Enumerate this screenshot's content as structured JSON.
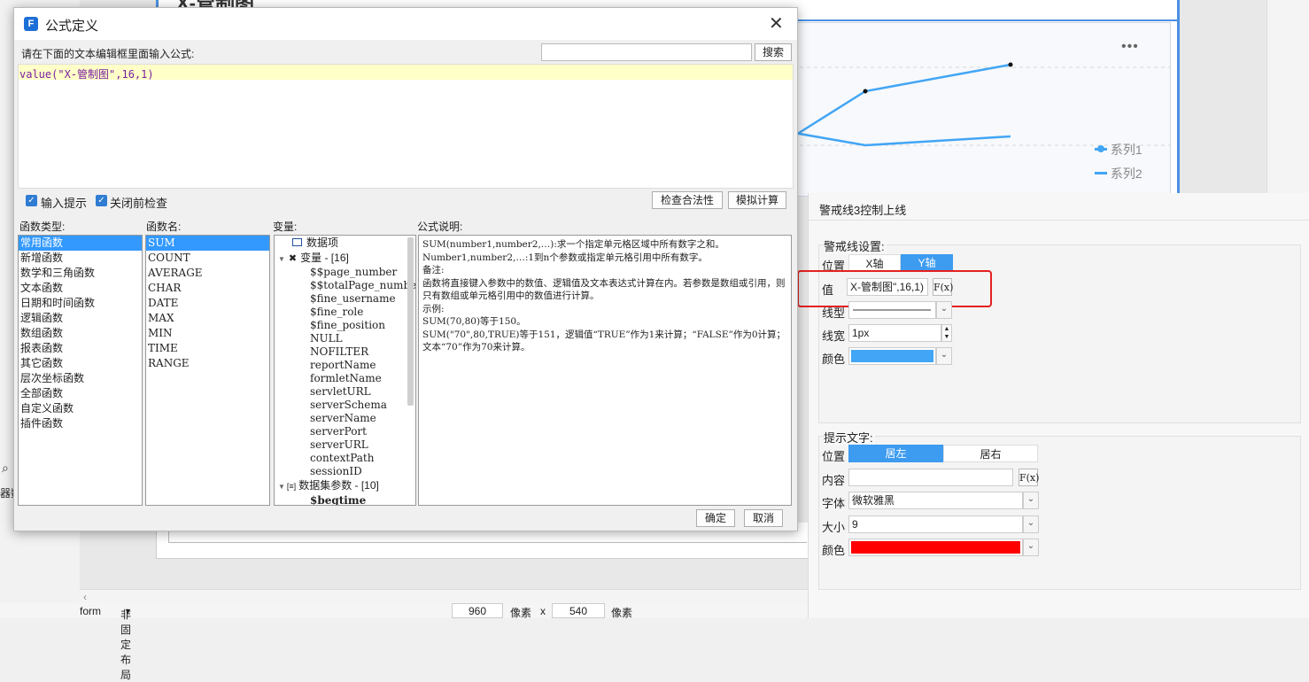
{
  "background": {
    "page_title_fragment": "X-管制图",
    "menu_dots": "•••",
    "legend": [
      {
        "name": "系列1"
      },
      {
        "name": "系列2"
      }
    ],
    "left_edge_fragment": "器数",
    "statusbar": {
      "form_label": "form",
      "layout_label": "非固定布局",
      "width_value": "960",
      "width_unit": "像素",
      "times": "x",
      "height_value": "540",
      "height_unit": "像素"
    }
  },
  "dialog": {
    "title": "公式定义",
    "prompt": "请在下面的文本编辑框里面输入公式:",
    "search_placeholder": "",
    "search_button": "搜索",
    "formula": "value(\"X-管制图\",16,1)",
    "checkbox_input_hint": "输入提示",
    "checkbox_check_before_close": "关闭前检查",
    "check_validity_button": "检查合法性",
    "simulate_button": "模拟计算",
    "col_function_types": "函数类型:",
    "col_function_names": "函数名:",
    "col_variables": "变量:",
    "col_description": "公式说明:",
    "function_types": [
      "常用函数",
      "新增函数",
      "数学和三角函数",
      "文本函数",
      "日期和时间函数",
      "逻辑函数",
      "数组函数",
      "报表函数",
      "其它函数",
      "层次坐标函数",
      "全部函数",
      "自定义函数",
      "插件函数"
    ],
    "function_names": [
      "SUM",
      "COUNT",
      "AVERAGE",
      "CHAR",
      "DATE",
      "MAX",
      "MIN",
      "TIME",
      "RANGE"
    ],
    "variables": {
      "data_items": "数据项",
      "vars_header": "变量 - [16]",
      "vars": [
        "$$page_number",
        "$$totalPage_number",
        "$fine_username",
        "$fine_role",
        "$fine_position",
        "NULL",
        "NOFILTER",
        "reportName",
        "formletName",
        "servletURL",
        "serverSchema",
        "serverName",
        "serverPort",
        "serverURL",
        "contextPath",
        "sessionID"
      ],
      "dataset_params": "数据集参数 - [10]",
      "dataset_first": "$begtime"
    },
    "description": [
      "SUM(number1,number2,…):求一个指定单元格区域中所有数字之和。",
      "Number1,number2,…:1到n个参数或指定单元格引用中所有数字。",
      "备注:",
      "函数将直接键入参数中的数值、逻辑值及文本表达式计算在内。若参数是数组或引用，则只有数组或单元格引用中的数值进行计算。",
      "示例:",
      "SUM(70,80)等于150。",
      "SUM(\"70\",80,TRUE)等于151，逻辑值“TRUE”作为1来计算；“FALSE”作为0计算；文本“70”作为70来计算。"
    ],
    "ok_button": "确定",
    "cancel_button": "取消"
  },
  "properties": {
    "title": "警戒线3控制上线",
    "warning_section": "警戒线设置:",
    "position_label": "位置",
    "x_axis": "X轴",
    "y_axis": "Y轴",
    "value_label": "值",
    "value_text": "X-管制图\",16,1)",
    "fx": "F(x)",
    "line_type_label": "线型",
    "line_width_label": "线宽",
    "line_width_value": "1px",
    "color_label": "颜色",
    "line_color": "#42a5f5",
    "tip_section": "提示文字:",
    "tip_position_label": "位置",
    "left": "居左",
    "right": "居右",
    "content_label": "内容",
    "content_value": "",
    "font_label": "字体",
    "font_value": "微软雅黑",
    "size_label": "大小",
    "size_value": "9",
    "tip_color_label": "颜色",
    "tip_color": "#ff0000"
  }
}
